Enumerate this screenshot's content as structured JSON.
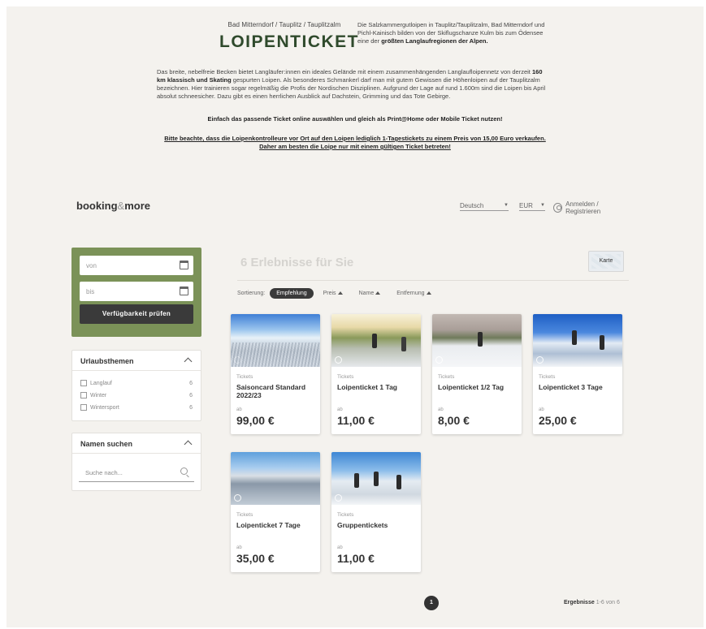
{
  "intro": {
    "kicker": "Bad Mitterndorf / Tauplitz / Tauplitzalm",
    "title": "LOIPENTICKET",
    "desc_plain": "Die Salzkammergutloipen in Tauplitz/Tauplitzalm, Bad Mitterndorf und Pichl-Kainisch bilden von der Skiflugschanze Kulm bis zum Ödensee eine der ",
    "desc_bold": "größten Langlaufregionen der Alpen.",
    "para_1": "Das breite, nebelfreie Becken bietet Langläufer:innen ein ideales Gelände mit einem zusammenhängenden Langlaufloipennetz von derzeit",
    "para_bold": "160 km klassisch und Skating",
    "para_2": " gespurten Loipen. Als besonderes Schmankerl darf man mit gutem Gewissen die Höhenloipen auf der Tauplitzalm bezeichnen. Hier trainieren sogar regelmäßig die Profis der Nordischen Disziplinen. Aufgrund der Lage auf rund 1.600m sind die Loipen bis April absolut schneesicher. Dazu gibt es einen herrlichen Ausblick auf Dachstein, Grimming und das Tote Gebirge.",
    "cta": "Einfach das passende Ticket online auswählen und gleich als Print@Home oder Mobile Ticket nutzen!",
    "note_1": "Bitte beachte, dass die Loipenkontrolleure vor Ort auf den Loipen lediglich 1-Tagestickets zu einem Preis von 15,00 Euro verkaufen.",
    "note_2": "Daher am besten die Loipe nur mit einem gültigen Ticket betreten!"
  },
  "topbar": {
    "logo_a": "booking",
    "logo_amp": "&",
    "logo_b": "more",
    "language": "Deutsch",
    "currency": "EUR",
    "login": "Anmelden / Registrieren"
  },
  "search": {
    "from_placeholder": "von",
    "to_placeholder": "bis",
    "check_button": "Verfügbarkeit prüfen"
  },
  "filters": {
    "themes_title": "Urlaubsthemen",
    "themes": [
      {
        "label": "Langlauf",
        "count": "6"
      },
      {
        "label": "Winter",
        "count": "6"
      },
      {
        "label": "Wintersport",
        "count": "6"
      }
    ],
    "name_title": "Namen suchen",
    "name_placeholder": "Suche nach..."
  },
  "results": {
    "title": "6 Erlebnisse für Sie",
    "map_button": "Karte",
    "sort_label": "Sortierung:",
    "sort_active": "Empfehlung",
    "sort_options": [
      "Preis",
      "Name",
      "Entfernung"
    ],
    "cards": [
      {
        "category": "Tickets",
        "name": "Saisoncard Standard 2022/23",
        "ab": "ab",
        "price": "99,00 €"
      },
      {
        "category": "Tickets",
        "name": "Loipenticket 1 Tag",
        "ab": "ab",
        "price": "11,00 €"
      },
      {
        "category": "Tickets",
        "name": "Loipenticket 1/2 Tag",
        "ab": "ab",
        "price": "8,00 €"
      },
      {
        "category": "Tickets",
        "name": "Loipenticket 3 Tage",
        "ab": "ab",
        "price": "25,00 €"
      },
      {
        "category": "Tickets",
        "name": "Loipenticket 7 Tage",
        "ab": "ab",
        "price": "35,00 €"
      },
      {
        "category": "Tickets",
        "name": "Gruppentickets",
        "ab": "ab",
        "price": "11,00 €"
      }
    ],
    "page": "1",
    "count_label": "Ergebnisse",
    "count_range": "1-6 von 6"
  }
}
